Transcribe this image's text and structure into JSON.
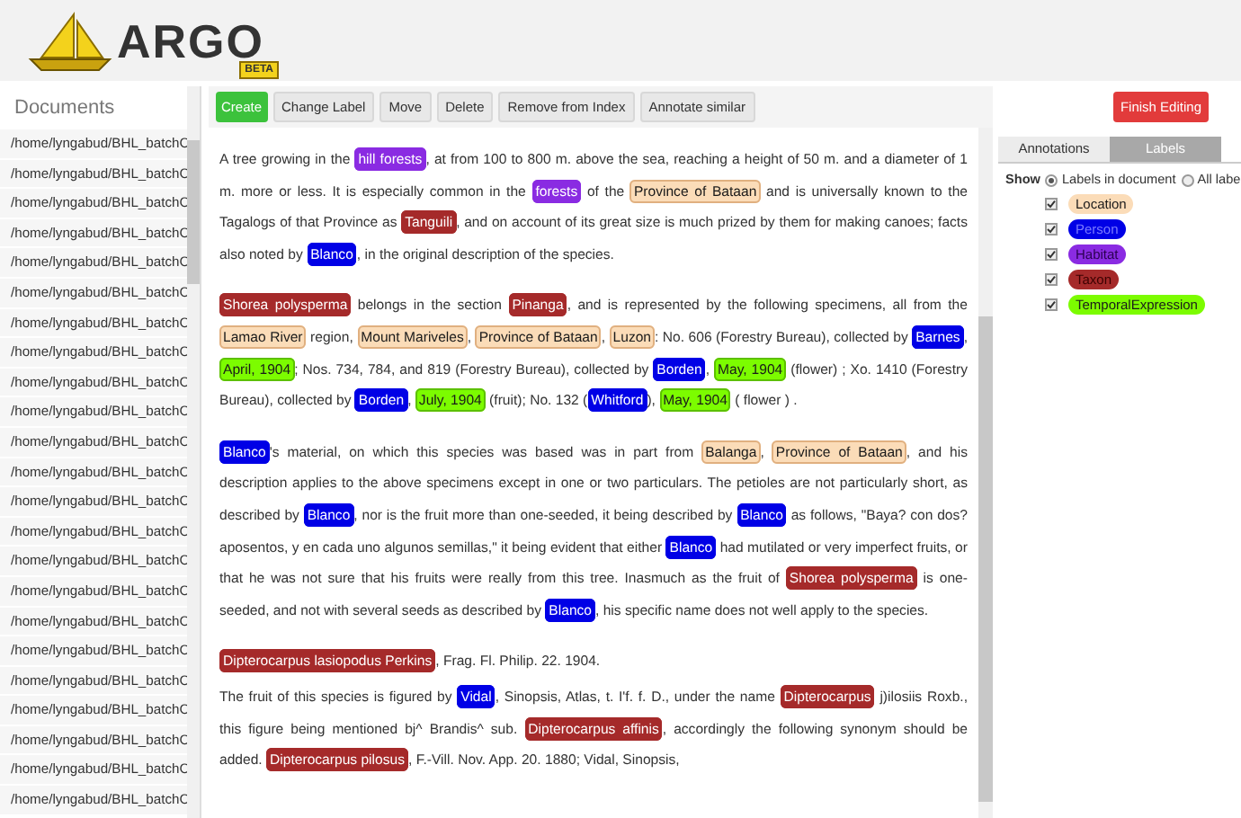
{
  "logo": {
    "name": "ARGO",
    "badge": "BETA"
  },
  "documents": {
    "title": "Documents",
    "items": [
      "/home/lyngabud/BHL_batchC",
      "/home/lyngabud/BHL_batchC",
      "/home/lyngabud/BHL_batchC",
      "/home/lyngabud/BHL_batchC",
      "/home/lyngabud/BHL_batchC",
      "/home/lyngabud/BHL_batchC",
      "/home/lyngabud/BHL_batchC",
      "/home/lyngabud/BHL_batchC",
      "/home/lyngabud/BHL_batchC",
      "/home/lyngabud/BHL_batchC",
      "/home/lyngabud/BHL_batchC",
      "/home/lyngabud/BHL_batchC",
      "/home/lyngabud/BHL_batchC",
      "/home/lyngabud/BHL_batchC",
      "/home/lyngabud/BHL_batchC",
      "/home/lyngabud/BHL_batchC",
      "/home/lyngabud/BHL_batchC",
      "/home/lyngabud/BHL_batchC",
      "/home/lyngabud/BHL_batchC",
      "/home/lyngabud/BHL_batchC",
      "/home/lyngabud/BHL_batchC",
      "/home/lyngabud/BHL_batchC",
      "/home/lyngabud/BHL_batchC"
    ]
  },
  "toolbar": [
    {
      "label": "Create",
      "kind": "primary"
    },
    {
      "label": "Change Label",
      "kind": "plain"
    },
    {
      "label": "Move",
      "kind": "plain"
    },
    {
      "label": "Delete",
      "kind": "plain"
    },
    {
      "label": "Remove from Index",
      "kind": "plain"
    },
    {
      "label": "Annotate similar",
      "kind": "plain"
    }
  ],
  "finish_button": "Finish Editing",
  "paragraphs": [
    [
      {
        "text": "A tree growing in the "
      },
      {
        "text": "hill forests",
        "kind": "habitat"
      },
      {
        "text": ", at from 100 to 800 m. above the sea, reaching a height of 50 m. and a diameter of 1 m. more or less. It is especially common in the "
      },
      {
        "text": "forests",
        "kind": "habitat"
      },
      {
        "text": " of the "
      },
      {
        "text": "Province of Bataan",
        "kind": "location"
      },
      {
        "text": " and is universally known to the Tagalogs of that Province as "
      },
      {
        "text": "Tanguili",
        "kind": "taxon"
      },
      {
        "text": ", and on account of its great size is much prized by them for making canoes; facts also noted by "
      },
      {
        "text": "Blanco",
        "kind": "person"
      },
      {
        "text": ", in the original description of the species."
      }
    ],
    [
      {
        "text": "Shorea polysperma",
        "kind": "taxon"
      },
      {
        "text": " belongs in the section "
      },
      {
        "text": "Pinanga",
        "kind": "taxon"
      },
      {
        "text": ", and is represented by the following specimens, all from the "
      },
      {
        "text": "Lamao River",
        "kind": "location"
      },
      {
        "text": " region, "
      },
      {
        "text": "Mount Mariveles",
        "kind": "location"
      },
      {
        "text": ", "
      },
      {
        "text": "Province of Bataan",
        "kind": "location"
      },
      {
        "text": ", "
      },
      {
        "text": "Luzon",
        "kind": "location"
      },
      {
        "text": ": No. 606 (Forestry Bureau), collected by "
      },
      {
        "text": "Barnes",
        "kind": "person"
      },
      {
        "text": ", "
      },
      {
        "text": "April, 1904",
        "kind": "temporal"
      },
      {
        "text": "; Nos. 734, 784, and 819 (Forestry Bureau), collected by "
      },
      {
        "text": "Borden",
        "kind": "person"
      },
      {
        "text": ", "
      },
      {
        "text": "May, 1904",
        "kind": "temporal"
      },
      {
        "text": " (flower) ; Xo. 1410 (Forestry Bureau), collected by "
      },
      {
        "text": "Borden",
        "kind": "person"
      },
      {
        "text": ", "
      },
      {
        "text": "July, 1904",
        "kind": "temporal"
      },
      {
        "text": " (fruit); No. 132 ("
      },
      {
        "text": "Whitford",
        "kind": "person"
      },
      {
        "text": "), "
      },
      {
        "text": "May, 1904",
        "kind": "temporal"
      },
      {
        "text": " ( flower ) ."
      }
    ],
    [
      {
        "text": "Blanco",
        "kind": "person"
      },
      {
        "text": "'s material, on which this species was based was in part from "
      },
      {
        "text": "Balanga",
        "kind": "location"
      },
      {
        "text": ", "
      },
      {
        "text": "Province of Bataan",
        "kind": "location"
      },
      {
        "text": ", and his description applies to the above specimens except in one or two particulars. The petioles are not particularly short, as described by "
      },
      {
        "text": "Blanco",
        "kind": "person"
      },
      {
        "text": ", nor is the fruit more than one-seeded, it being described by "
      },
      {
        "text": "Blanco",
        "kind": "person"
      },
      {
        "text": " as follows, \"Baya? con dos? aposentos, y en cada uno algunos semillas,\" it being evident that either "
      },
      {
        "text": "Blanco",
        "kind": "person"
      },
      {
        "text": " had mutilated or very imperfect fruits, or that he was not sure that his fruits were really from this tree. Inasmuch as the fruit of "
      },
      {
        "text": "Shorea polysperma",
        "kind": "taxon"
      },
      {
        "text": " is one-seeded, and not with several seeds as described by "
      },
      {
        "text": "Blanco",
        "kind": "person"
      },
      {
        "text": ", his specific name does not well apply to the species."
      }
    ],
    [
      {
        "text": "Dipterocarpus lasiopodus Perkins",
        "kind": "taxon"
      },
      {
        "text": ", Frag. Fl. Philip. 22. 1904."
      }
    ],
    [
      {
        "text": "The fruit of this species is figured by "
      },
      {
        "text": "Vidal",
        "kind": "person"
      },
      {
        "text": ", Sinopsis, Atlas, t. I'f. f. D., under the name "
      },
      {
        "text": "Dipterocarpus",
        "kind": "taxon"
      },
      {
        "text": " j)ilosiis Roxb., this figure being mentioned bj^ Brandis^ sub. "
      },
      {
        "text": "Dipterocarpus affinis",
        "kind": "taxon"
      },
      {
        "text": ", accordingly the following synonym should be added. "
      },
      {
        "text": "Dipterocarpus pilosus",
        "kind": "taxon"
      },
      {
        "text": ", F.-Vill. Nov. App. 20. 1880; Vidal, Sinopsis,"
      }
    ]
  ],
  "side_tabs": [
    {
      "label": "Annotations",
      "selected": false
    },
    {
      "label": "Labels",
      "selected": true
    }
  ],
  "show": {
    "label": "Show",
    "options": [
      {
        "label": "Labels in document",
        "selected": true
      },
      {
        "label": "All labe",
        "selected": false
      }
    ]
  },
  "labels": [
    {
      "name": "Location",
      "kind": "location",
      "color": "#fbdcb8",
      "checked": true
    },
    {
      "name": "Person",
      "kind": "person",
      "color": "#0000e6",
      "checked": true
    },
    {
      "name": "Habitat",
      "kind": "habitat",
      "color": "#8a2be2",
      "checked": true
    },
    {
      "name": "Taxon",
      "kind": "taxon",
      "color": "#a52a2a",
      "checked": true
    },
    {
      "name": "TemporalExpression",
      "kind": "temporal",
      "color": "#7cfc00",
      "checked": true
    }
  ]
}
